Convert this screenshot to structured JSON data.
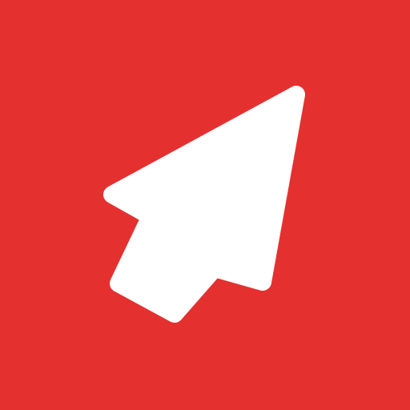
{
  "icon": {
    "name": "cursor-arrow-icon",
    "background_color": "#E53030",
    "foreground_color": "#FFFFFF"
  }
}
